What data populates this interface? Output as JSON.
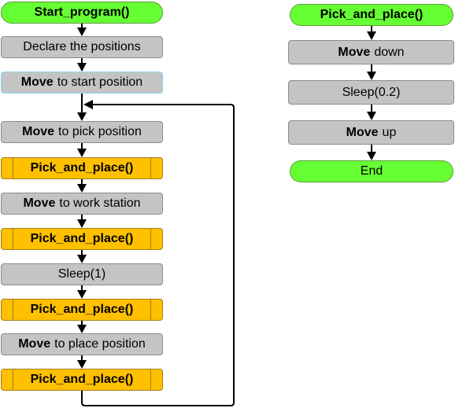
{
  "main_flow": {
    "nodes": [
      {
        "id": "start_program",
        "type": "terminal",
        "bold": "Start_program()",
        "text": ""
      },
      {
        "id": "declare",
        "type": "process",
        "bold": "",
        "text": "Declare the positions"
      },
      {
        "id": "move_start",
        "type": "process",
        "bold": "Move",
        "text": "to start position",
        "highlight": true
      },
      {
        "id": "move_pick",
        "type": "process",
        "bold": "Move",
        "text": "to pick position"
      },
      {
        "id": "pp1",
        "type": "subprocess",
        "bold": "Pick_and_place()",
        "text": ""
      },
      {
        "id": "move_work",
        "type": "process",
        "bold": "Move",
        "text": "to work station"
      },
      {
        "id": "pp2",
        "type": "subprocess",
        "bold": "Pick_and_place()",
        "text": ""
      },
      {
        "id": "sleep1",
        "type": "process",
        "bold": "",
        "text": "Sleep(1)"
      },
      {
        "id": "pp3",
        "type": "subprocess",
        "bold": "Pick_and_place()",
        "text": ""
      },
      {
        "id": "move_place",
        "type": "process",
        "bold": "Move",
        "text": "to place position"
      },
      {
        "id": "pp4",
        "type": "subprocess",
        "bold": "Pick_and_place()",
        "text": ""
      }
    ],
    "loop": {
      "from": "pp4",
      "to": "move_pick"
    }
  },
  "sub_flow": {
    "nodes": [
      {
        "id": "pp_start",
        "type": "terminal",
        "bold": "Pick_and_place()",
        "text": ""
      },
      {
        "id": "move_down",
        "type": "process",
        "bold": "Move",
        "text": "down"
      },
      {
        "id": "sleep02",
        "type": "process",
        "bold": "",
        "text": "Sleep(0.2)"
      },
      {
        "id": "move_up",
        "type": "process",
        "bold": "Move",
        "text": "up"
      },
      {
        "id": "end",
        "type": "terminal",
        "bold": "",
        "text": "End",
        "plain": true
      }
    ]
  },
  "colors": {
    "terminal": "#66ff33",
    "process": "#c4c4c4",
    "subprocess": "#ffc000",
    "arrow": "#000000"
  }
}
